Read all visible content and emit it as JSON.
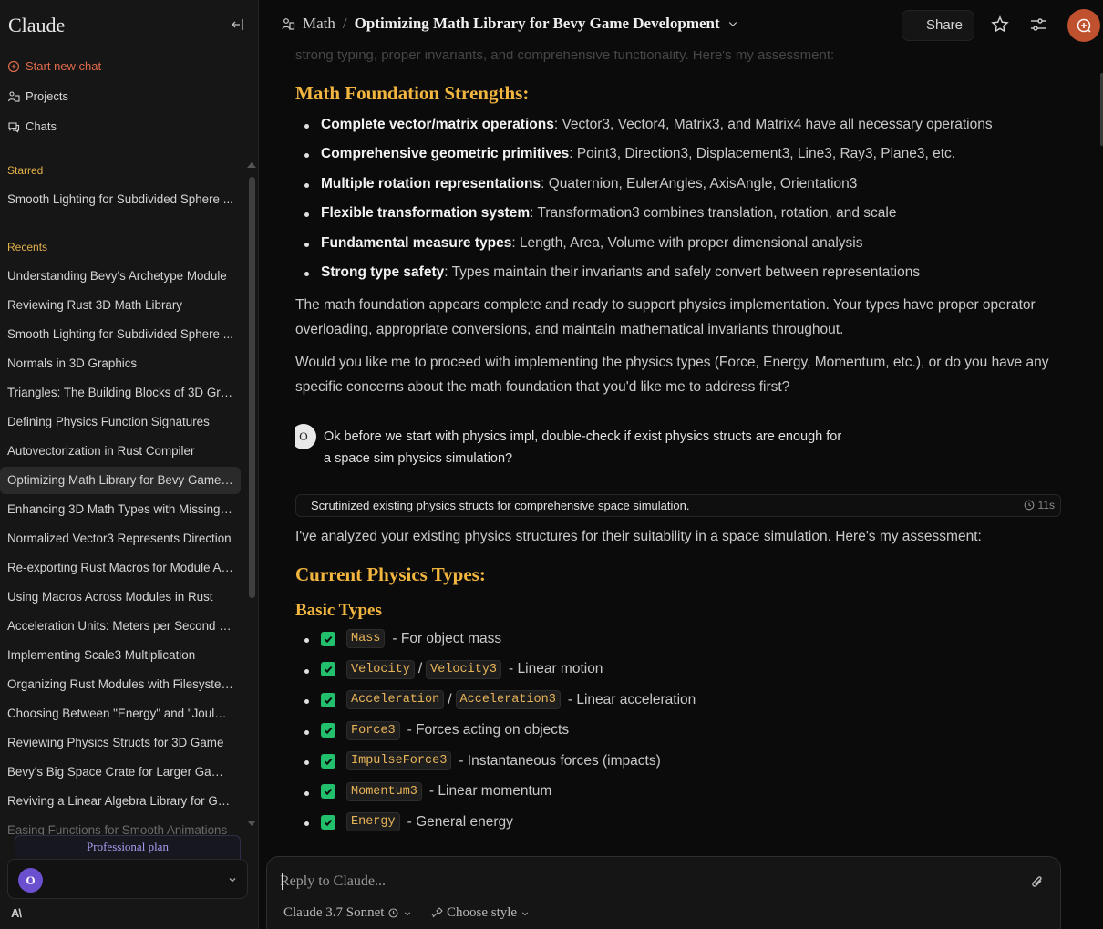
{
  "sidebar": {
    "brand": "Claude",
    "new_chat": "Start new chat",
    "projects": "Projects",
    "chats": "Chats",
    "starred_label": "Starred",
    "starred": [
      "Smooth Lighting for Subdivided Sphere ..."
    ],
    "recents_label": "Recents",
    "recents": [
      "Understanding Bevy's Archetype Module",
      "Reviewing Rust 3D Math Library",
      "Smooth Lighting for Subdivided Sphere ...",
      "Normals in 3D Graphics",
      "Triangles: The Building Blocks of 3D Grap...",
      "Defining Physics Function Signatures",
      "Autovectorization in Rust Compiler",
      "Optimizing Math Library for Bevy Game ...",
      "Enhancing 3D Math Types with Missing ...",
      "Normalized Vector3 Represents Direction",
      "Re-exporting Rust Macros for Module Ac...",
      "Using Macros Across Modules in Rust",
      "Acceleration Units: Meters per Second Sq...",
      "Implementing Scale3 Multiplication",
      "Organizing Rust Modules with Filesystem...",
      "Choosing Between \"Energy\" and \"Joules\"...",
      "Reviewing Physics Structs for 3D Game",
      "Bevy's Big Space Crate for Larger Game ...",
      "Reviving a Linear Algebra Library for Ga...",
      "Easing Functions for Smooth Animations"
    ],
    "active_index": 7,
    "plan": "Professional plan",
    "avatar_initial": "O"
  },
  "header": {
    "project": "Math",
    "separator": "/",
    "title": "Optimizing Math Library for Bevy Game Development",
    "share": "Share"
  },
  "conversation": {
    "ghost_line": "strong typing, proper invariants, and comprehensive functionality. Here's my assessment:",
    "section1_title": "Math Foundation Strengths:",
    "strengths": [
      {
        "bold": "Complete vector/matrix operations",
        "text": ": Vector3, Vector4, Matrix3, and Matrix4 have all necessary operations"
      },
      {
        "bold": "Comprehensive geometric primitives",
        "text": ": Point3, Direction3, Displacement3, Line3, Ray3, Plane3, etc."
      },
      {
        "bold": "Multiple rotation representations",
        "text": ": Quaternion, EulerAngles, AxisAngle, Orientation3"
      },
      {
        "bold": "Flexible transformation system",
        "text": ": Transformation3 combines translation, rotation, and scale"
      },
      {
        "bold": "Fundamental measure types",
        "text": ": Length, Area, Volume with proper dimensional analysis"
      },
      {
        "bold": "Strong type safety",
        "text": ": Types maintain their invariants and safely convert between representations"
      }
    ],
    "para1": "The math foundation appears complete and ready to support physics implementation. Your types have proper operator overloading, appropriate conversions, and maintain mathematical invariants throughout.",
    "para2": "Would you like me to proceed with implementing the physics types (Force, Energy, Momentum, etc.), or do you have any specific concerns about the math foundation that you'd like me to address first?",
    "user_initial": "O",
    "user_message": "Ok before we start with physics impl, double-check if exist physics structs are enough for a space sim physics simulation?",
    "thinking_summary": "Scrutinized existing physics structs for comprehensive space simulation.",
    "thinking_time": "11s",
    "reply_intro": "I've analyzed your existing physics structures for their suitability in a space simulation. Here's my assessment:",
    "section2_title": "Current Physics Types:",
    "subsection_title": "Basic Types",
    "basic_types": [
      {
        "codes": [
          "Mass"
        ],
        "desc": "- For object mass"
      },
      {
        "codes": [
          "Velocity",
          "Velocity3"
        ],
        "desc": "- Linear motion"
      },
      {
        "codes": [
          "Acceleration",
          "Acceleration3"
        ],
        "desc": "- Linear acceleration"
      },
      {
        "codes": [
          "Force3"
        ],
        "desc": "- Forces acting on objects"
      },
      {
        "codes": [
          "ImpulseForce3"
        ],
        "desc": "- Instantaneous forces (impacts)"
      },
      {
        "codes": [
          "Momentum3"
        ],
        "desc": "- Linear momentum"
      },
      {
        "codes": [
          "Energy"
        ],
        "desc": "- General energy"
      }
    ]
  },
  "composer": {
    "placeholder": "Reply to Claude...",
    "model": "Claude 3.7 Sonnet",
    "style": "Choose style"
  },
  "colors": {
    "accent": "#f2b640",
    "brand_orange": "#c0512e",
    "check_green": "#22c06c",
    "plan_purple": "#a99cf0"
  }
}
